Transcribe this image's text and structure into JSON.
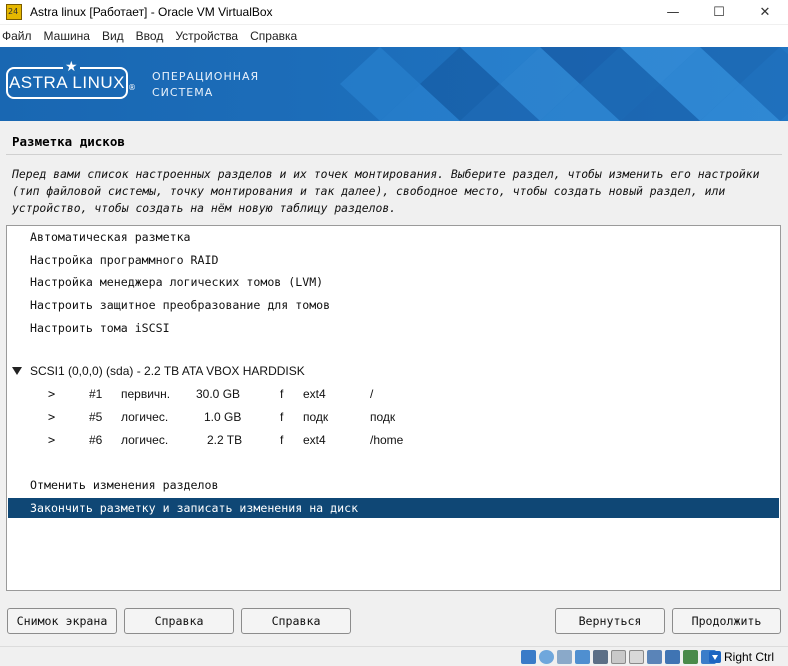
{
  "window": {
    "title": "Astra linux [Работает] - Oracle VM VirtualBox",
    "minimize_glyph": "—",
    "maximize_glyph": "☐",
    "close_glyph": "✕"
  },
  "menu": [
    "Файл",
    "Машина",
    "Вид",
    "Ввод",
    "Устройства",
    "Справка"
  ],
  "banner": {
    "logo": "ASTRA LINUX",
    "logo_star": "★",
    "logo_reg": "®",
    "subtitle_line1": "ОПЕРАЦИОННАЯ",
    "subtitle_line2": "СИСТЕМА",
    "color": "#1b6bb5"
  },
  "page": {
    "heading": "Разметка дисков",
    "description": "Перед вами список настроенных разделов и их точек монтирования. Выберите раздел, чтобы изменить его настройки (тип файловой системы, точку монтирования и так далее), свободное место, чтобы создать новый раздел, или устройство, чтобы создать на нём новую таблицу разделов."
  },
  "list": {
    "top_items": [
      "Автоматическая разметка",
      "Настройка программного RAID",
      "Настройка менеджера логических томов (LVM)",
      "Настроить защитное преобразование для томов",
      "Настроить тома iSCSI"
    ],
    "disk": "SCSI1 (0,0,0) (sda) - 2.2 TB ATA VBOX HARDDISK",
    "partitions": [
      {
        "arrow": ">",
        "num": "#1",
        "type": "первичн.",
        "size": "30.0 GB",
        "flag": "f",
        "fs": "ext4",
        "mount": "/"
      },
      {
        "arrow": ">",
        "num": "#5",
        "type": "логичес.",
        "size": "1.0 GB",
        "flag": "f",
        "fs": "подк",
        "mount": "подк"
      },
      {
        "arrow": ">",
        "num": "#6",
        "type": "логичес.",
        "size": "2.2 TB",
        "flag": "f",
        "fs": "ext4",
        "mount": "/home"
      }
    ],
    "undo": "Отменить изменения разделов",
    "finish": "Закончить разметку и записать изменения на диск",
    "selected_color": "#0f4775"
  },
  "buttons": {
    "screenshot": "Снимок экрана",
    "help1": "Справка",
    "help2": "Справка",
    "back": "Вернуться",
    "continue": "Продолжить"
  },
  "statusbar": {
    "host_key": "Right Ctrl",
    "icons": [
      "hdd-icon",
      "optical-drive-icon",
      "audio-icon",
      "network-icon",
      "usb-icon",
      "shared-folders-icon",
      "display-icon",
      "video-capture-icon",
      "recording-icon",
      "cpu-icon",
      "mouse-integration-icon",
      "keyboard-icon"
    ]
  }
}
